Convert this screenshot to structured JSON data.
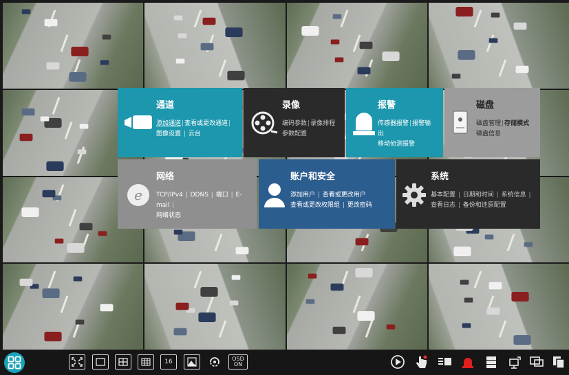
{
  "menu": {
    "tiles": [
      {
        "title": "通道",
        "icon": "camera-icon",
        "links": [
          "添加通道",
          "查看或更改通道",
          "图像设置",
          "云台"
        ],
        "color": "#1c97ad"
      },
      {
        "title": "录像",
        "icon": "film-reel-icon",
        "links": [
          "编码参数",
          "录像排程",
          "参数配置"
        ],
        "color": "#2a2a2a"
      },
      {
        "title": "报警",
        "icon": "alarm-light-icon",
        "links": [
          "传感器报警",
          "报警输出",
          "移动侦测报警"
        ],
        "color": "#1c97ad"
      },
      {
        "title": "磁盘",
        "icon": "disk-icon",
        "links": [
          "磁盘管理",
          "存储模式",
          "磁盘信息"
        ],
        "color": "#9c9c9c"
      },
      {
        "title": "网络",
        "icon": "network-globe-icon",
        "links": [
          "TCP/IPv4",
          "DDNS",
          "端口",
          "E-mail",
          "网络状态"
        ],
        "color": "#8f8f8f"
      },
      {
        "title": "账户和安全",
        "icon": "user-icon",
        "links": [
          "添加用户",
          "查看或更改用户",
          "查看或更改权限组",
          "更改密码"
        ],
        "color": "#2c5d8f"
      },
      {
        "title": "系统",
        "icon": "gear-icon",
        "links": [
          "基本配置",
          "日期和时间",
          "系统信息",
          "查看日志",
          "备份和还原配置"
        ],
        "color": "#2a2a2a"
      }
    ]
  },
  "taskbar": {
    "start_icon": "start-menu-icon",
    "layout_buttons": [
      "fullscreen-icon",
      "layout-1-icon",
      "layout-4-icon",
      "layout-9-icon",
      "layout-16-icon",
      "image-icon",
      "rotate-icon"
    ],
    "layout16_label": "16",
    "osd_label_top": "OSD",
    "osd_label_bottom": "ON",
    "right_buttons": [
      "playback-icon",
      "manual-record-icon",
      "record-list-icon",
      "alarm-icon",
      "disk-status-icon",
      "network-status-icon",
      "monitor-icon",
      "copy-icon"
    ]
  }
}
